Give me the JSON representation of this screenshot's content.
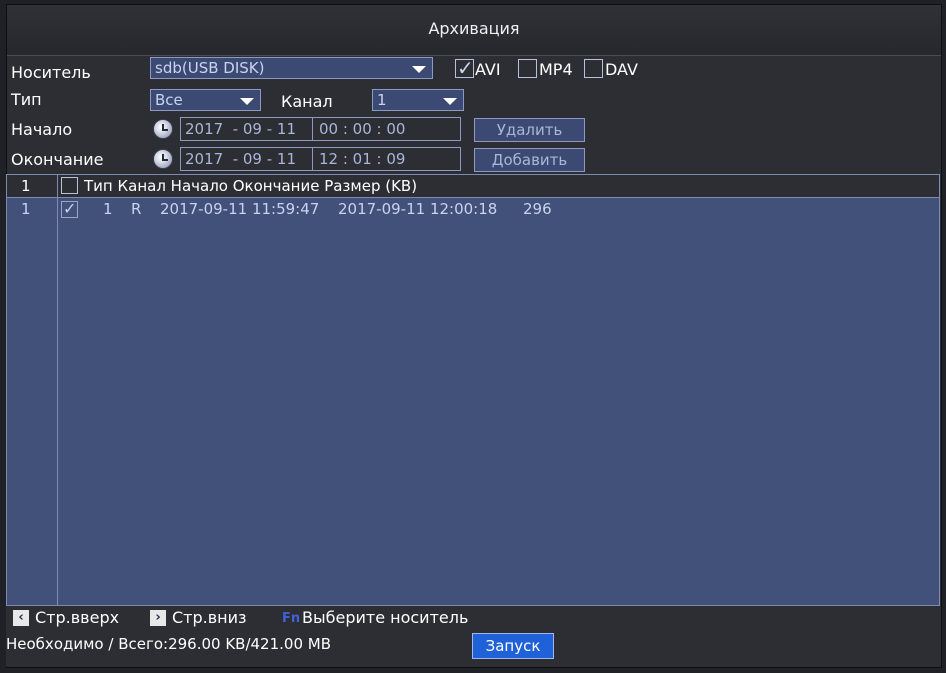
{
  "window": {
    "title": "Архивация"
  },
  "form": {
    "device_label": "Носитель",
    "device_value": "sdb(USB DISK)",
    "formats": [
      {
        "label": "AVI",
        "checked": true
      },
      {
        "label": "MP4",
        "checked": false
      },
      {
        "label": "DAV",
        "checked": false
      }
    ],
    "type_label": "Тип",
    "type_value": "Все",
    "channel_label": "Канал",
    "channel_value": "1",
    "start_label": "Начало",
    "start_date": "2017  - 09 - 11",
    "start_time": "00 : 00 : 00",
    "end_label": "Окончание",
    "end_date": "2017  - 09 - 11",
    "end_time": "12 : 01 : 09",
    "delete_button": "Удалить",
    "add_button": "Добавить"
  },
  "table": {
    "header": {
      "index": "1",
      "columns": "Тип Канал Начало Окончание Размер (KB)"
    },
    "rows": [
      {
        "index": "1",
        "checked": true,
        "channel": "1",
        "type": "R",
        "start": "2017-09-11 11:59:47",
        "end": "2017-09-11 12:00:18",
        "size": "296"
      }
    ]
  },
  "footer": {
    "page_up": "Стр.вверх",
    "page_down": "Стр.вниз",
    "fn_key": "Fn",
    "select_device": "Выберите носитель",
    "summary": "Необходимо / Всего:296.00 KB/421.00 MB",
    "start_button": "Запуск"
  },
  "colors": {
    "background": "#2c2e34",
    "table_bg": "#415179",
    "field_bg": "#3c4a73",
    "border": "#8b99c3",
    "start_button": "#1f62d8"
  }
}
